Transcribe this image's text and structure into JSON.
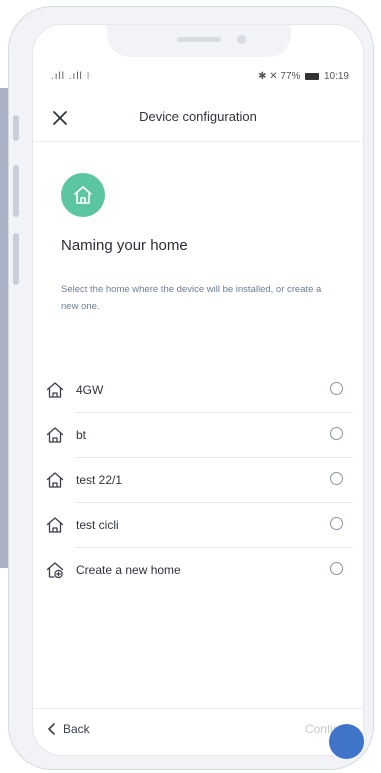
{
  "status": {
    "left_signals": ".ıll .ıll ⁝",
    "right": "✱ ✕ 77%",
    "time": "10:19"
  },
  "header": {
    "title": "Device configuration"
  },
  "main": {
    "heading": "Naming your home",
    "subtitle": "Select the home where the device will be installed, or create a new one."
  },
  "homes": [
    {
      "label": "4GW",
      "icon": "house-icon"
    },
    {
      "label": "bt",
      "icon": "house-icon"
    },
    {
      "label": "test 22/1",
      "icon": "house-icon"
    },
    {
      "label": "test cicli",
      "icon": "house-icon"
    },
    {
      "label": "Create a new home",
      "icon": "house-add-icon"
    }
  ],
  "footer": {
    "back_label": "Back",
    "continue_label": "Continue"
  },
  "colors": {
    "accent_green": "#5cc6a0",
    "fab_blue": "#3f74c9",
    "subtitle_text": "#6d7e98"
  }
}
